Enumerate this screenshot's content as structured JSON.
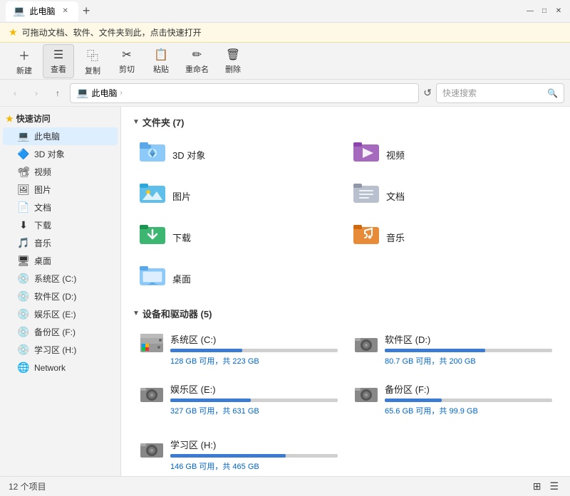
{
  "titleBar": {
    "tab": "此电脑",
    "tabIcon": "💻",
    "closeIcon": "✕",
    "newTabIcon": "+",
    "controls": [
      "—",
      "□",
      "✕"
    ]
  },
  "tip": {
    "star": "★",
    "text": "可拖动文档、软件、文件夹到此，点击快速打开"
  },
  "toolbar": {
    "items": [
      {
        "icon": "＋",
        "label": "新建"
      },
      {
        "icon": "☰",
        "label": "查看",
        "active": true
      },
      {
        "icon": "⿻",
        "label": "复制"
      },
      {
        "icon": "✂",
        "label": "剪切"
      },
      {
        "icon": "📋",
        "label": "粘贴"
      },
      {
        "icon": "✏",
        "label": "重命名"
      },
      {
        "icon": "🗑",
        "label": "删除"
      }
    ]
  },
  "addressBar": {
    "back": "‹",
    "forward": "›",
    "up": "↑",
    "pathIcon": "💻",
    "path": "此电脑",
    "pathSep": "›",
    "searchPlaceholder": "快速搜索"
  },
  "sidebar": {
    "quickAccess": {
      "label": "快速访问",
      "icon": "★"
    },
    "thisPC": {
      "label": "此电脑",
      "icon": "💻",
      "active": true
    },
    "items": [
      {
        "label": "3D 对象",
        "icon": "🔷"
      },
      {
        "label": "视频",
        "icon": "📽"
      },
      {
        "label": "图片",
        "icon": "🖼"
      },
      {
        "label": "文档",
        "icon": "📄"
      },
      {
        "label": "下载",
        "icon": "⬇"
      },
      {
        "label": "音乐",
        "icon": "🎵"
      },
      {
        "label": "桌面",
        "icon": "🖥"
      },
      {
        "label": "系统区 (C:)",
        "icon": "💿"
      },
      {
        "label": "软件区 (D:)",
        "icon": "💿"
      },
      {
        "label": "娱乐区 (E:)",
        "icon": "💿"
      },
      {
        "label": "备份区 (F:)",
        "icon": "💿"
      },
      {
        "label": "学习区 (H:)",
        "icon": "💿"
      }
    ],
    "network": {
      "label": "Network",
      "icon": "🌐"
    }
  },
  "content": {
    "foldersSection": {
      "chevron": "▼",
      "title": "文件夹 (7)",
      "folders": [
        {
          "name": "3D 对象",
          "icon": "🔷"
        },
        {
          "name": "视频",
          "icon": "📽"
        },
        {
          "name": "图片",
          "icon": "🖼"
        },
        {
          "name": "文档",
          "icon": "📁"
        },
        {
          "name": "下载",
          "icon": "⬇"
        },
        {
          "name": "音乐",
          "icon": "🎵"
        },
        {
          "name": "桌面",
          "icon": "🖥"
        }
      ]
    },
    "drivesSection": {
      "chevron": "▼",
      "title": "设备和驱动器 (5)",
      "drives": [
        {
          "name": "系统区 (C:)",
          "icon": "💻",
          "usedPct": 43,
          "freeSpace": "128 GB 可用，共 223 GB",
          "barColor": "blue"
        },
        {
          "name": "软件区 (D:)",
          "icon": "💽",
          "usedPct": 60,
          "freeSpace": "80.7 GB 可用，共 200 GB",
          "barColor": "blue"
        },
        {
          "name": "娱乐区 (E:)",
          "icon": "💽",
          "usedPct": 48,
          "freeSpace": "327 GB 可用，共 631 GB",
          "barColor": "blue"
        },
        {
          "name": "备份区 (F:)",
          "icon": "💽",
          "usedPct": 34,
          "freeSpace": "65.6 GB 可用，共 99.9 GB",
          "barColor": "blue"
        },
        {
          "name": "学习区 (H:)",
          "icon": "💽",
          "usedPct": 69,
          "freeSpace": "146 GB 可用，共 465 GB",
          "barColor": "blue"
        }
      ]
    }
  },
  "statusBar": {
    "count": "12 个项目",
    "viewIcons": [
      "⊞",
      "☰"
    ]
  }
}
